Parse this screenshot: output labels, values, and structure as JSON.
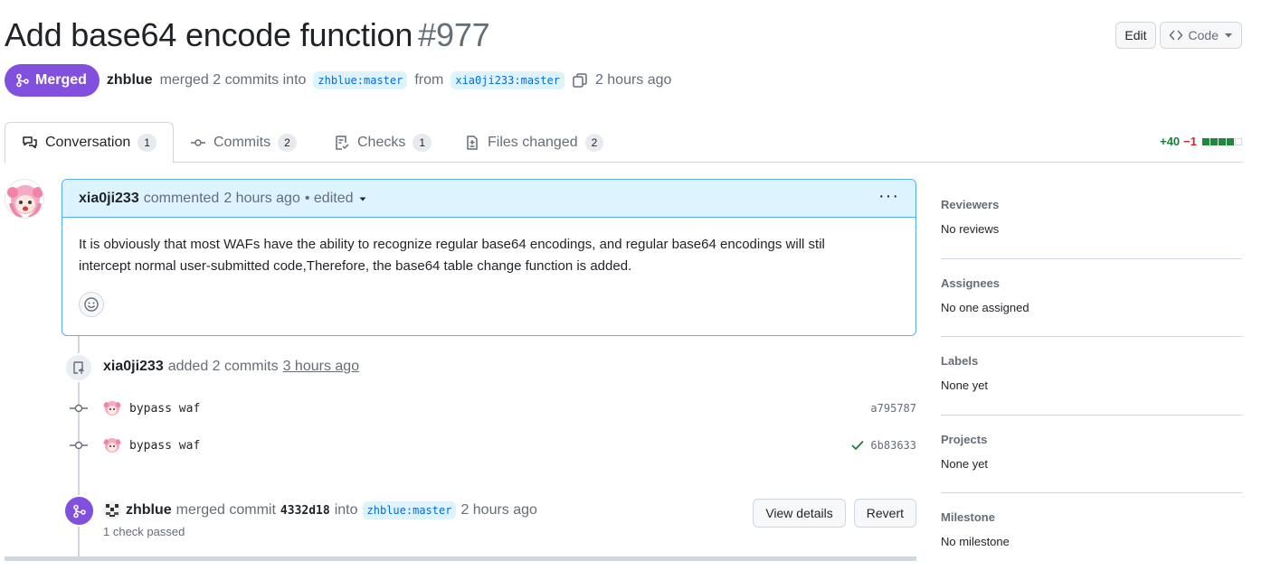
{
  "header": {
    "title": "Add base64 encode function",
    "number": "#977",
    "edit_label": "Edit",
    "code_label": "Code"
  },
  "meta": {
    "state": "Merged",
    "author": "zhblue",
    "action": "merged 2 commits into",
    "base_branch": "zhblue:master",
    "from": "from",
    "head_branch": "xia0ji233:master",
    "time": "2 hours ago"
  },
  "tabs": [
    {
      "label": "Conversation",
      "count": "1"
    },
    {
      "label": "Commits",
      "count": "2"
    },
    {
      "label": "Checks",
      "count": "1"
    },
    {
      "label": "Files changed",
      "count": "2"
    }
  ],
  "diffstat": {
    "additions": "+40",
    "deletions": "−1"
  },
  "comment": {
    "author": "xia0ji233",
    "action": "commented",
    "time": "2 hours ago",
    "edited": "• edited",
    "body_line1": "It is obviously that most WAFs have the ability to recognize regular base64 encodings, and regular base64 encodings will stil",
    "body_line2": "intercept normal user-submitted code,Therefore, the base64 table change function is added."
  },
  "commits_event": {
    "author": "xia0ji233",
    "action": "added 2 commits",
    "time": "3 hours ago",
    "commits": [
      {
        "message": "bypass waf",
        "sha": "a795787"
      },
      {
        "message": "bypass waf",
        "sha": "6b83633"
      }
    ]
  },
  "merge_event": {
    "author": "zhblue",
    "action": "merged commit",
    "sha": "4332d18",
    "into": "into",
    "branch": "zhblue:master",
    "time": "2 hours ago",
    "checks": "1 check passed",
    "view_details": "View details",
    "revert": "Revert"
  },
  "sidebar": [
    {
      "label": "Reviewers",
      "value": "No reviews"
    },
    {
      "label": "Assignees",
      "value": "No one assigned"
    },
    {
      "label": "Labels",
      "value": "None yet"
    },
    {
      "label": "Projects",
      "value": "None yet"
    },
    {
      "label": "Milestone",
      "value": "No milestone"
    }
  ],
  "colors": {
    "merged": "#8250df",
    "link": "#0969da",
    "addition": "#1a7f37",
    "deletion": "#cf222e",
    "comment_header": "#ddf4ff"
  }
}
